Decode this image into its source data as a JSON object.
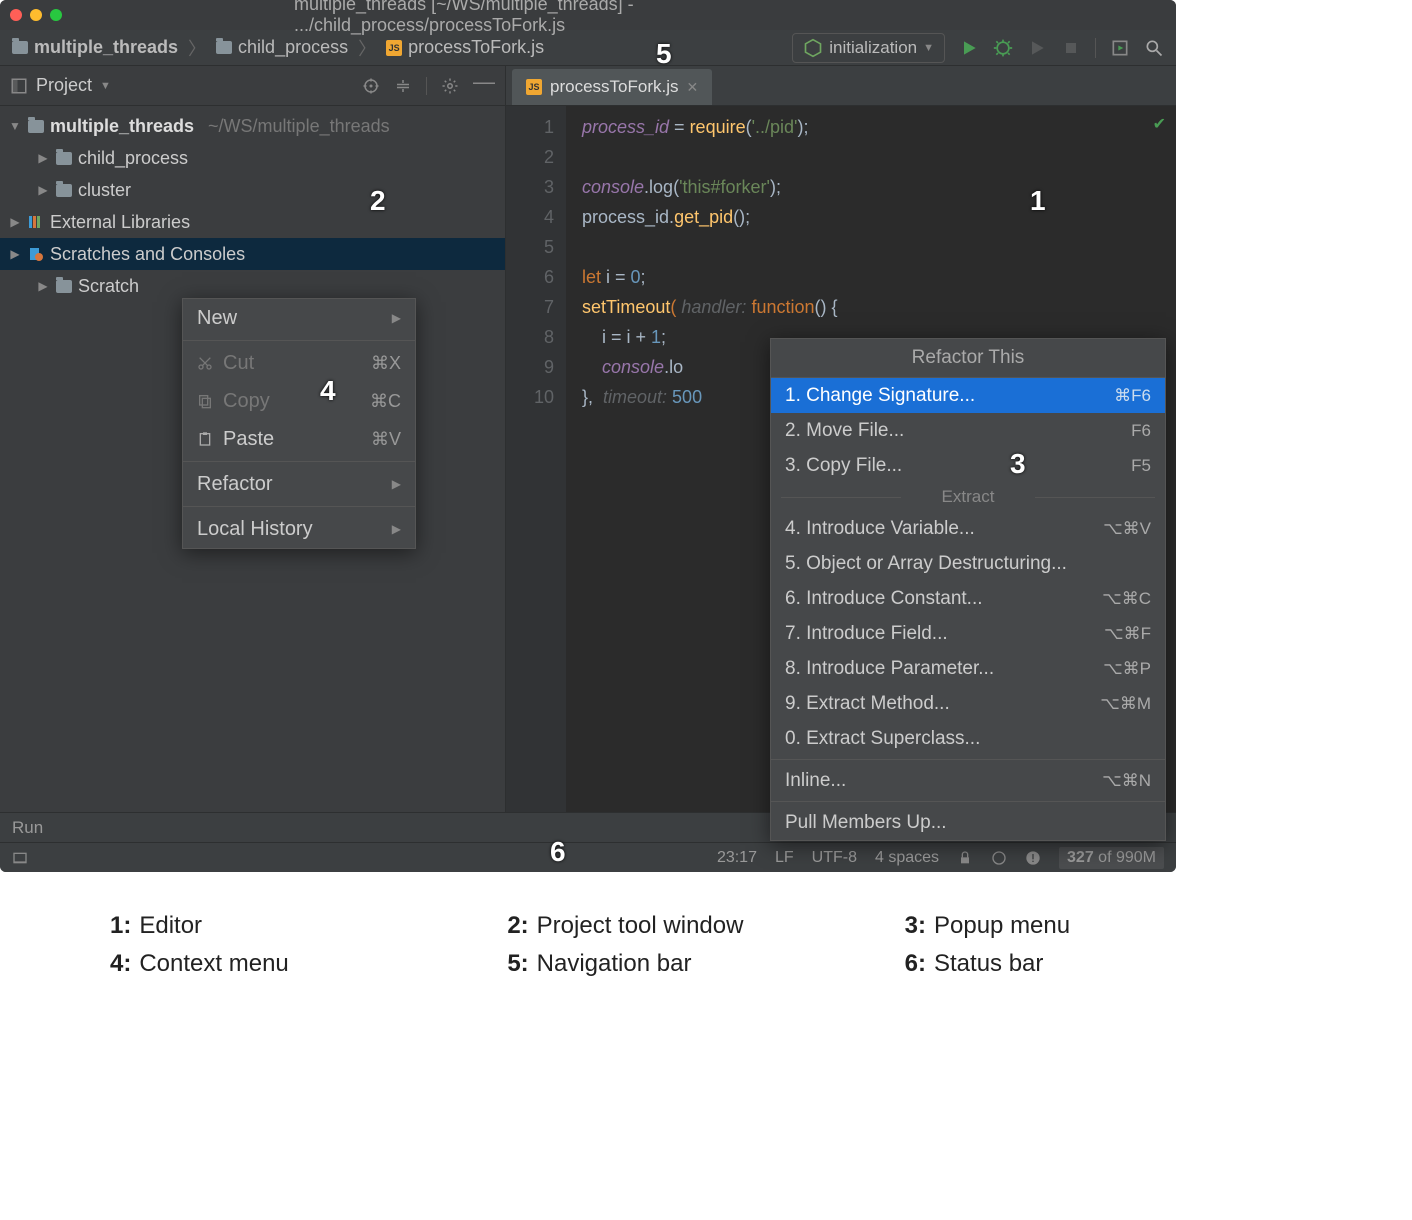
{
  "title": "multiple_threads [~/WS/multiple_threads] - .../child_process/processToFork.js",
  "breadcrumb": {
    "b1": "multiple_threads",
    "b2": "child_process",
    "b3": "processToFork.js"
  },
  "runConfig": "initialization",
  "sidebar": {
    "title": "Project",
    "proj": "multiple_threads",
    "projPath": "~/WS/multiple_threads",
    "n_child": "child_process",
    "n_cluster": "cluster",
    "n_ext": "External Libraries",
    "n_scratch": "Scratches and Consoles",
    "n_scratches": "Scratch"
  },
  "tab": "processToFork.js",
  "code": {
    "l1a": "process_id",
    "l1b": " = ",
    "l1c": "require",
    "l1d": "(",
    "l1e": "'../pid'",
    "l1f": ");",
    "l3a": "console",
    "l3b": ".log(",
    "l3c": "'this#forker'",
    "l3d": ");",
    "l4a": "process_id.",
    "l4b": "get_pid",
    "l4c": "();",
    "l6a": "let ",
    "l6b": "i = ",
    "l6c": "0",
    "l6d": ";",
    "l7a": "setTimeout",
    "l7b": "(",
    "l7h": " handler: ",
    "l7c": "function",
    "l7d": "() {",
    "l8a": "    i = i + ",
    "l8b": "1",
    "l8c": ";",
    "l9a": "    ",
    "l9b": "console",
    "l9c": ".lo",
    "l10a": "}, ",
    "l10h": " timeout: ",
    "l10b": "500"
  },
  "gutter": [
    "1",
    "2",
    "3",
    "4",
    "5",
    "6",
    "7",
    "8",
    "9",
    "10"
  ],
  "ctx": {
    "new": "New",
    "cut": "Cut",
    "cut_sc": "⌘X",
    "copy": "Copy",
    "copy_sc": "⌘C",
    "paste": "Paste",
    "paste_sc": "⌘V",
    "refactor": "Refactor",
    "history": "Local History"
  },
  "refactor": {
    "title": "Refactor This",
    "r1": "1. Change Signature...",
    "r1s": "⌘F6",
    "r2": "2. Move File...",
    "r2s": "F6",
    "r3": "3. Copy File...",
    "r3s": "F5",
    "extract": "Extract",
    "r4": "4. Introduce Variable...",
    "r4s": "⌥⌘V",
    "r5": "5. Object or Array Destructuring...",
    "r6": "6. Introduce Constant...",
    "r6s": "⌥⌘C",
    "r7": "7. Introduce Field...",
    "r7s": "⌥⌘F",
    "r8": "8. Introduce Parameter...",
    "r8s": "⌥⌘P",
    "r9": "9. Extract Method...",
    "r9s": "⌥⌘M",
    "r0": "0. Extract Superclass...",
    "inline": "Inline...",
    "inline_s": "⌥⌘N",
    "pull": "Pull Members Up..."
  },
  "run": "Run",
  "status": {
    "pos": "23:17",
    "le": "LF",
    "enc": "UTF-8",
    "indent": "4 spaces",
    "mem": "327",
    "memTotal": " of 990M"
  },
  "legend": {
    "l1": "Editor",
    "l2": "Project tool window",
    "l3": "Popup menu",
    "l4": "Context menu",
    "l5": "Navigation bar",
    "l6": "Status bar"
  }
}
